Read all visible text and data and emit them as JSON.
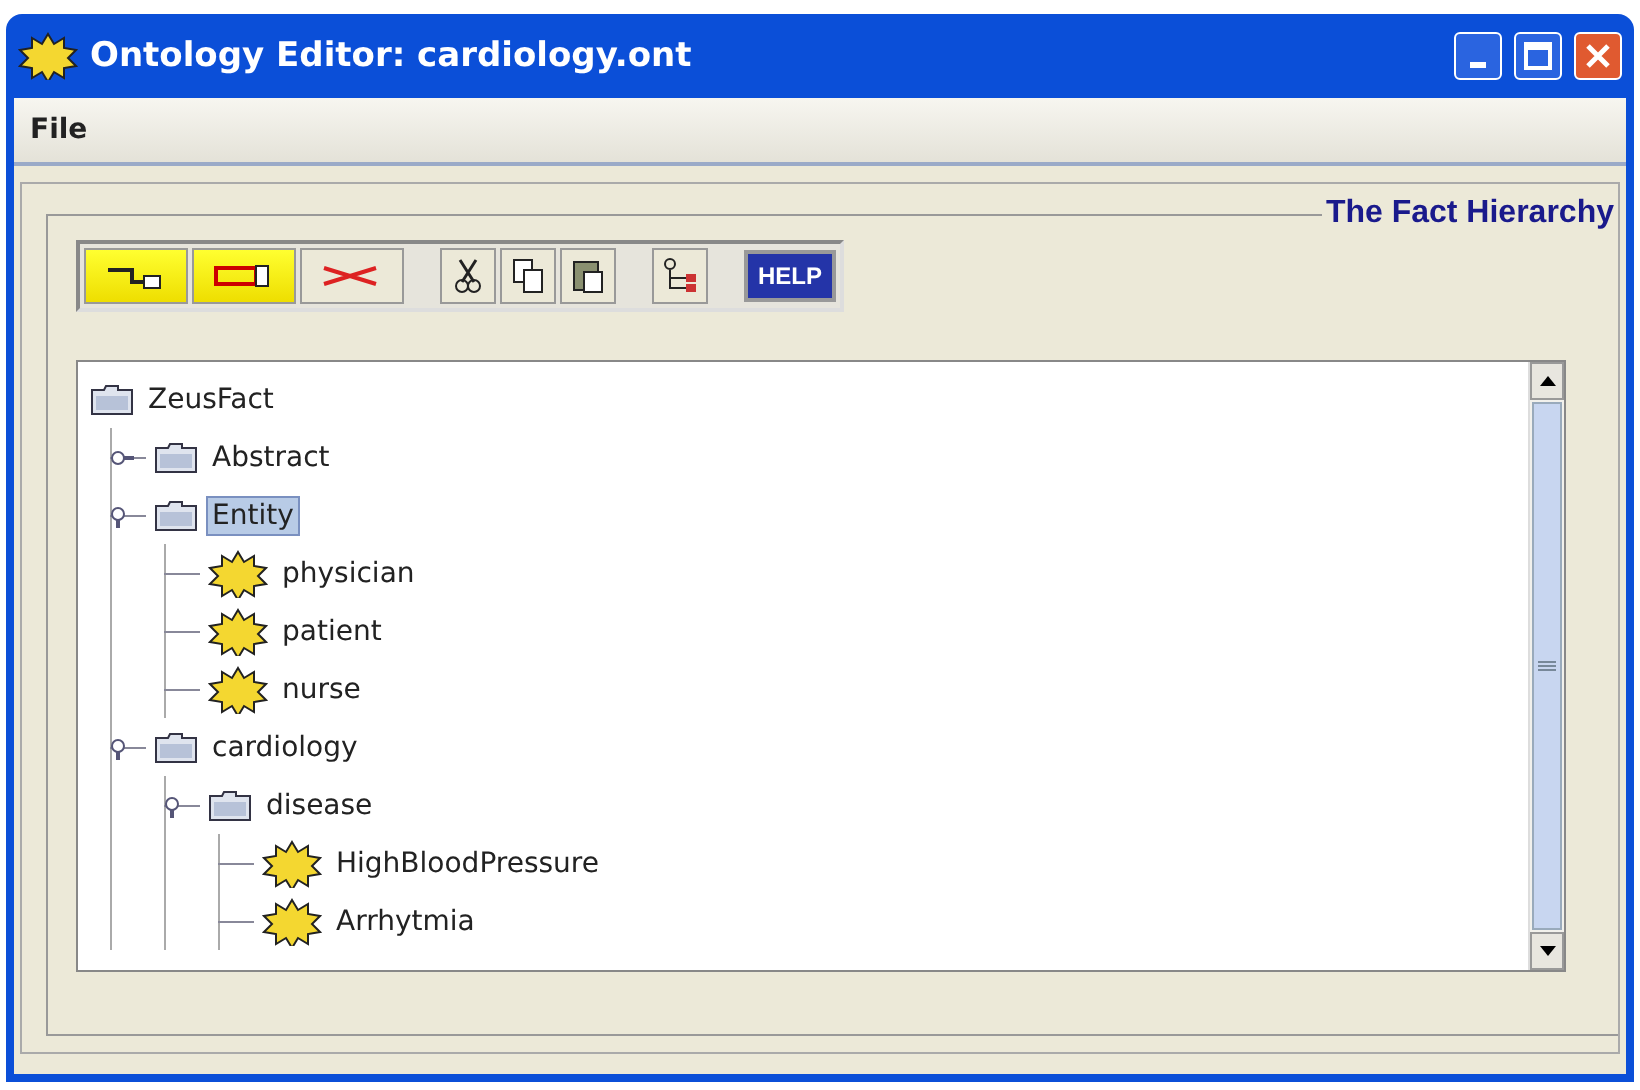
{
  "window": {
    "title": "Ontology Editor: cardiology.ont"
  },
  "menu": [
    "File"
  ],
  "panel": {
    "title": "The Fact Hierarchy"
  },
  "toolbar": [
    {
      "kind": "add-fact"
    },
    {
      "kind": "add-folder"
    },
    {
      "kind": "delete"
    },
    {
      "kind": "sep"
    },
    {
      "kind": "cut"
    },
    {
      "kind": "copy"
    },
    {
      "kind": "paste"
    },
    {
      "kind": "sep"
    },
    {
      "kind": "tree"
    },
    {
      "kind": "sep"
    },
    {
      "kind": "help",
      "label": "HELP"
    }
  ],
  "tree": {
    "label": "ZeusFact",
    "kind": "folder",
    "selected": false,
    "children": [
      {
        "label": "Abstract",
        "kind": "folder",
        "expanded": false,
        "selected": false
      },
      {
        "label": "Entity",
        "kind": "folder",
        "expanded": true,
        "selected": true,
        "children": [
          {
            "label": "physician",
            "kind": "fact",
            "selected": false
          },
          {
            "label": "patient",
            "kind": "fact",
            "selected": false
          },
          {
            "label": "nurse",
            "kind": "fact",
            "selected": false
          }
        ]
      },
      {
        "label": "cardiology",
        "kind": "folder",
        "expanded": true,
        "selected": false,
        "children": [
          {
            "label": "disease",
            "kind": "folder",
            "expanded": true,
            "selected": false,
            "children": [
              {
                "label": "HighBloodPressure",
                "kind": "fact",
                "selected": false
              },
              {
                "label": "Arrhytmia",
                "kind": "fact",
                "selected": false
              }
            ]
          }
        ]
      }
    ]
  }
}
